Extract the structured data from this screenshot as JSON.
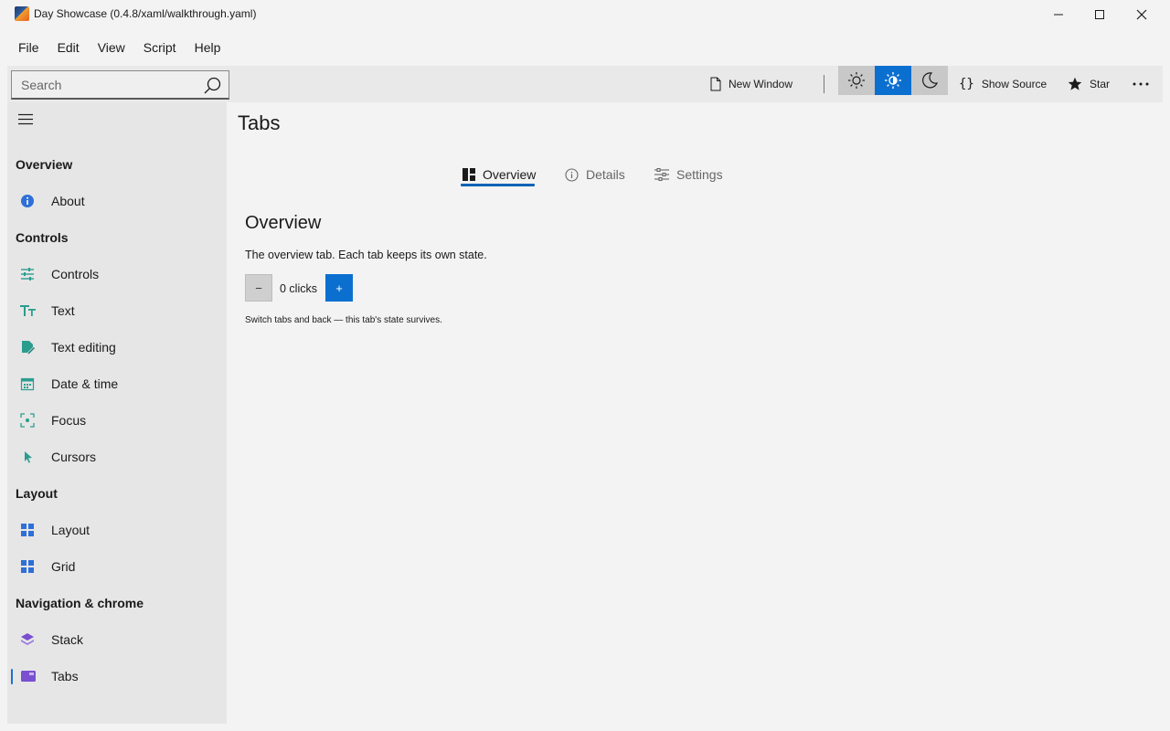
{
  "window": {
    "title": "Day Showcase (0.4.8/xaml/walkthrough.yaml)"
  },
  "menu": [
    "File",
    "Edit",
    "View",
    "Script",
    "Help"
  ],
  "toolbar": {
    "search_placeholder": "Search",
    "new_window": "New Window",
    "show_source": "Show Source",
    "star": "Star",
    "active_theme": "auto",
    "accent_color": "#0b6fd0"
  },
  "sidebar": {
    "sections": [
      {
        "title": "Overview",
        "items": [
          {
            "label": "About",
            "icon": "info-icon"
          }
        ]
      },
      {
        "title": "Controls",
        "items": [
          {
            "label": "Controls",
            "icon": "sliders-icon"
          },
          {
            "label": "Text",
            "icon": "text-icon"
          },
          {
            "label": "Text editing",
            "icon": "edit-icon"
          },
          {
            "label": "Date & time",
            "icon": "calendar-icon"
          },
          {
            "label": "Focus",
            "icon": "focus-icon"
          },
          {
            "label": "Cursors",
            "icon": "cursor-icon"
          }
        ]
      },
      {
        "title": "Layout",
        "items": [
          {
            "label": "Layout",
            "icon": "layout-icon"
          },
          {
            "label": "Grid",
            "icon": "grid-icon"
          }
        ]
      },
      {
        "title": "Navigation & chrome",
        "items": [
          {
            "label": "Stack",
            "icon": "stack-icon"
          },
          {
            "label": "Tabs",
            "icon": "tabs-icon"
          }
        ]
      }
    ],
    "selected": "Tabs"
  },
  "main": {
    "page_title": "Tabs",
    "tabs": [
      {
        "label": "Overview",
        "icon": "dashboard-icon",
        "active": true
      },
      {
        "label": "Details",
        "icon": "info-icon",
        "active": false
      },
      {
        "label": "Settings",
        "icon": "settings-sliders-icon",
        "active": false
      }
    ],
    "content": {
      "title": "Overview",
      "description": "The overview tab. Each tab keeps its own state.",
      "minus": "−",
      "plus": "+",
      "clicks": "0 clicks",
      "hint": "Switch tabs and back — this tab's state survives."
    }
  }
}
